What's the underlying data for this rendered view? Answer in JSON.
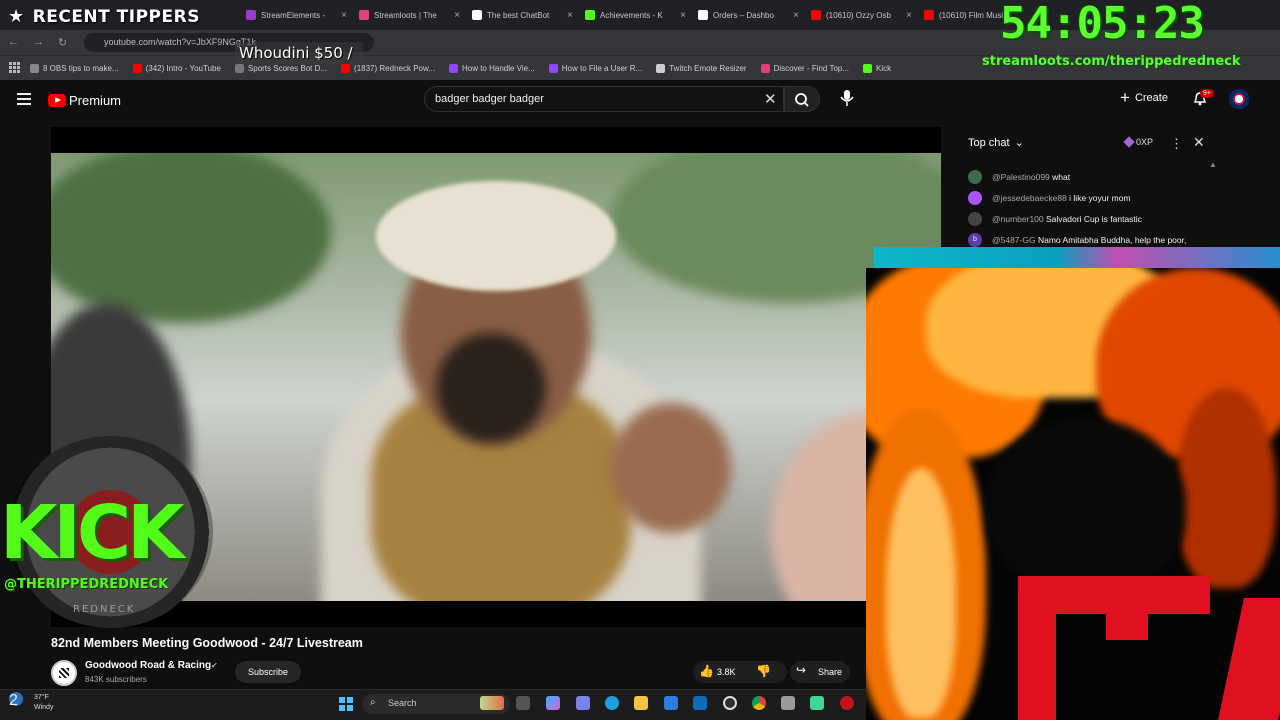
{
  "overlay": {
    "recent_tippers": "RECENT TIPPERS",
    "tipper": "Whoudini $50 /",
    "timer": "54:05:23",
    "streamloots_url": "streamloots.com/therippedredneck",
    "kick_logo": "KICK",
    "kick_handle": "@THERIPPEDREDNECK",
    "redneck_label": "REDNECK"
  },
  "browser": {
    "tabs": [
      {
        "label": "StreamElements -",
        "color": "#9c3bd1"
      },
      {
        "label": "Streamloots | The",
        "color": "#e0417a"
      },
      {
        "label": "The best ChatBot",
        "color": "#ffffff"
      },
      {
        "label": "Achievements - K",
        "color": "#53fc18"
      },
      {
        "label": "Orders – Dashbo",
        "color": "#ffffff"
      },
      {
        "label": "(10610) Ozzy Osb",
        "color": "#ff0000"
      },
      {
        "label": "(10610) Film Musi",
        "color": "#ff0000"
      }
    ],
    "url": "youtube.com/watch?v=JbXF9NGgT1k",
    "bookmarks": [
      {
        "label": "8 OBS tips to make...",
        "color": "#888888"
      },
      {
        "label": "(342) Intro - YouTube",
        "color": "#ff0000"
      },
      {
        "label": "Sports Scores Bot D...",
        "color": "#777777"
      },
      {
        "label": "(1837) Redneck Pow...",
        "color": "#ff0000"
      },
      {
        "label": "How to Handle Vie...",
        "color": "#9146ff"
      },
      {
        "label": "How to File a User R...",
        "color": "#9146ff"
      },
      {
        "label": "Twitch Emote Resizer",
        "color": "#cccccc"
      },
      {
        "label": "Discover - Find Top...",
        "color": "#e0417a"
      },
      {
        "label": "Kick",
        "color": "#53fc18"
      }
    ]
  },
  "youtube": {
    "logo_text": "Premium",
    "search_value": "badger badger badger",
    "create_label": "Create",
    "notif_count": "9+",
    "video_title": "82nd Members Meeting Goodwood - 24/7 Livestream",
    "channel_name": "Goodwood Road & Racing",
    "subscribers": "843K subscribers",
    "subscribe_label": "Subscribe",
    "like_count": "3.8K",
    "share_label": "Share"
  },
  "chat": {
    "mode": "Top chat",
    "xp": "0XP",
    "messages": [
      {
        "user": "@Palestino099",
        "text": "what",
        "avatar": "#3e6b4d",
        "initial": ""
      },
      {
        "user": "@jessedebaecke88",
        "text": "i like yoyur mom",
        "avatar": "#a855f7",
        "initial": ""
      },
      {
        "user": "@number100",
        "text": "Salvadori Cup is fantastic",
        "avatar": "#444444",
        "initial": ""
      },
      {
        "user": "@5487-GG",
        "text": "Namo Amitabha Buddha, help the poor,",
        "avatar": "#5b3fa8",
        "initial": "b"
      }
    ]
  },
  "taskbar": {
    "temp": "37°F",
    "condition": "Windy",
    "weather_badge": "2",
    "search_label": "Search"
  }
}
